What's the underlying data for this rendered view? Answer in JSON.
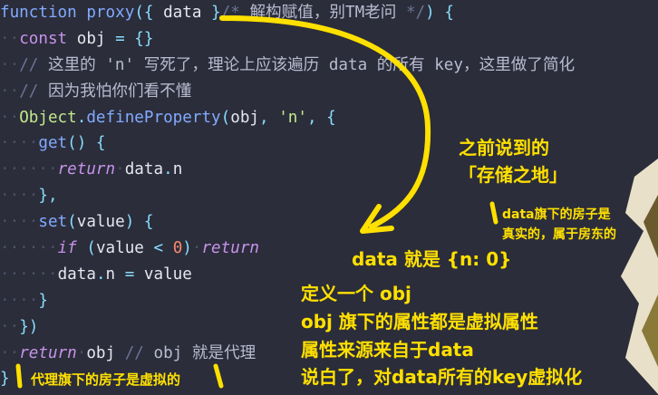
{
  "code_lines": [
    [
      {
        "t": "function",
        "c": "fn"
      },
      {
        "t": " "
      },
      {
        "t": "proxy",
        "c": "fn"
      },
      {
        "t": "({ ",
        "c": "op"
      },
      {
        "t": "data"
      },
      {
        "t": " }",
        "c": "op"
      },
      {
        "t": "/* ",
        "c": "cmt"
      },
      {
        "t": "解构赋值，别TM老问",
        "c": "cmt-cn"
      },
      {
        "t": " */",
        "c": "cmt"
      },
      {
        "t": ") {",
        "c": "op"
      }
    ],
    [
      {
        "t": "··",
        "c": "guide"
      },
      {
        "t": "const",
        "c": "kw"
      },
      {
        "t": " obj "
      },
      {
        "t": "=",
        "c": "op"
      },
      {
        "t": " {}",
        "c": "op"
      }
    ],
    [
      {
        "t": "··",
        "c": "guide"
      },
      {
        "t": "// ",
        "c": "cmt"
      },
      {
        "t": "这里的 ",
        "c": "cmt-cn"
      },
      {
        "t": "'n'",
        "c": "cmt-cn"
      },
      {
        "t": " 写死了，理论上应该遍历 ",
        "c": "cmt-cn"
      },
      {
        "t": "data",
        "c": "cmt-cn"
      },
      {
        "t": " 的所有 ",
        "c": "cmt-cn"
      },
      {
        "t": "key",
        "c": "cmt-cn"
      },
      {
        "t": "，这里做了简化",
        "c": "cmt-cn"
      }
    ],
    [
      {
        "t": "··",
        "c": "guide"
      },
      {
        "t": "// ",
        "c": "cmt"
      },
      {
        "t": "因为我怕你们看不懂",
        "c": "cmt-cn"
      }
    ],
    [
      {
        "t": "··",
        "c": "guide"
      },
      {
        "t": "Object",
        "c": "str"
      },
      {
        "t": ".",
        "c": "op"
      },
      {
        "t": "defineProperty",
        "c": "fn"
      },
      {
        "t": "(",
        "c": "op"
      },
      {
        "t": "obj"
      },
      {
        "t": ", ",
        "c": "op"
      },
      {
        "t": "'n'",
        "c": "str"
      },
      {
        "t": ", {",
        "c": "op"
      }
    ],
    [
      {
        "t": "····",
        "c": "guide"
      },
      {
        "t": "get",
        "c": "fn"
      },
      {
        "t": "() {",
        "c": "op"
      }
    ],
    [
      {
        "t": "······",
        "c": "guide"
      },
      {
        "t": "return",
        "c": "kw it"
      },
      {
        "t": "·",
        "c": "guide"
      },
      {
        "t": "data"
      },
      {
        "t": ".",
        "c": "op"
      },
      {
        "t": "n"
      }
    ],
    [
      {
        "t": "····",
        "c": "guide"
      },
      {
        "t": "},",
        "c": "op"
      }
    ],
    [
      {
        "t": "····",
        "c": "guide"
      },
      {
        "t": "set",
        "c": "fn"
      },
      {
        "t": "(",
        "c": "op"
      },
      {
        "t": "value"
      },
      {
        "t": ") {",
        "c": "op"
      }
    ],
    [
      {
        "t": "······",
        "c": "guide"
      },
      {
        "t": "if",
        "c": "kw it"
      },
      {
        "t": " (",
        "c": "op"
      },
      {
        "t": "value "
      },
      {
        "t": "<",
        "c": "op"
      },
      {
        "t": " "
      },
      {
        "t": "0",
        "c": "num"
      },
      {
        "t": ")",
        "c": "op"
      },
      {
        "t": "·",
        "c": "guide"
      },
      {
        "t": "return",
        "c": "kw it"
      }
    ],
    [
      {
        "t": "······",
        "c": "guide"
      },
      {
        "t": "data"
      },
      {
        "t": ".",
        "c": "op"
      },
      {
        "t": "n "
      },
      {
        "t": "=",
        "c": "op"
      },
      {
        "t": " value"
      }
    ],
    [
      {
        "t": "····",
        "c": "guide"
      },
      {
        "t": "}",
        "c": "op"
      }
    ],
    [
      {
        "t": "··",
        "c": "guide"
      },
      {
        "t": "})",
        "c": "op"
      }
    ],
    [
      {
        "t": "··",
        "c": "guide"
      },
      {
        "t": "return",
        "c": "kw it"
      },
      {
        "t": "·",
        "c": "guide"
      },
      {
        "t": "obj "
      },
      {
        "t": "//",
        "c": "cmt"
      },
      {
        "t": " obj ",
        "c": "cmt-cn"
      },
      {
        "t": "就是代理",
        "c": "cmt-cn"
      }
    ],
    [
      {
        "t": "}",
        "c": "op"
      }
    ]
  ],
  "annotations": {
    "storage_title_1": "之前说到的",
    "storage_title_2": "「存储之地」",
    "data_house_1": "data旗下的房子是",
    "data_house_2": "真实的，属于房东的",
    "data_value": "data 就是 {n: 0}",
    "define_1": "定义一个 obj",
    "define_2": "obj 旗下的属性都是虚拟属性",
    "define_3": "属性来源来自于data",
    "define_4": "说白了，对data所有的key虚拟化",
    "proxy_house": "代理旗下的房子是虚拟的"
  },
  "colors": {
    "background": "#2b2d3a",
    "highlight_yellow": "#ffe000",
    "annotation_white": "#ffffff"
  }
}
